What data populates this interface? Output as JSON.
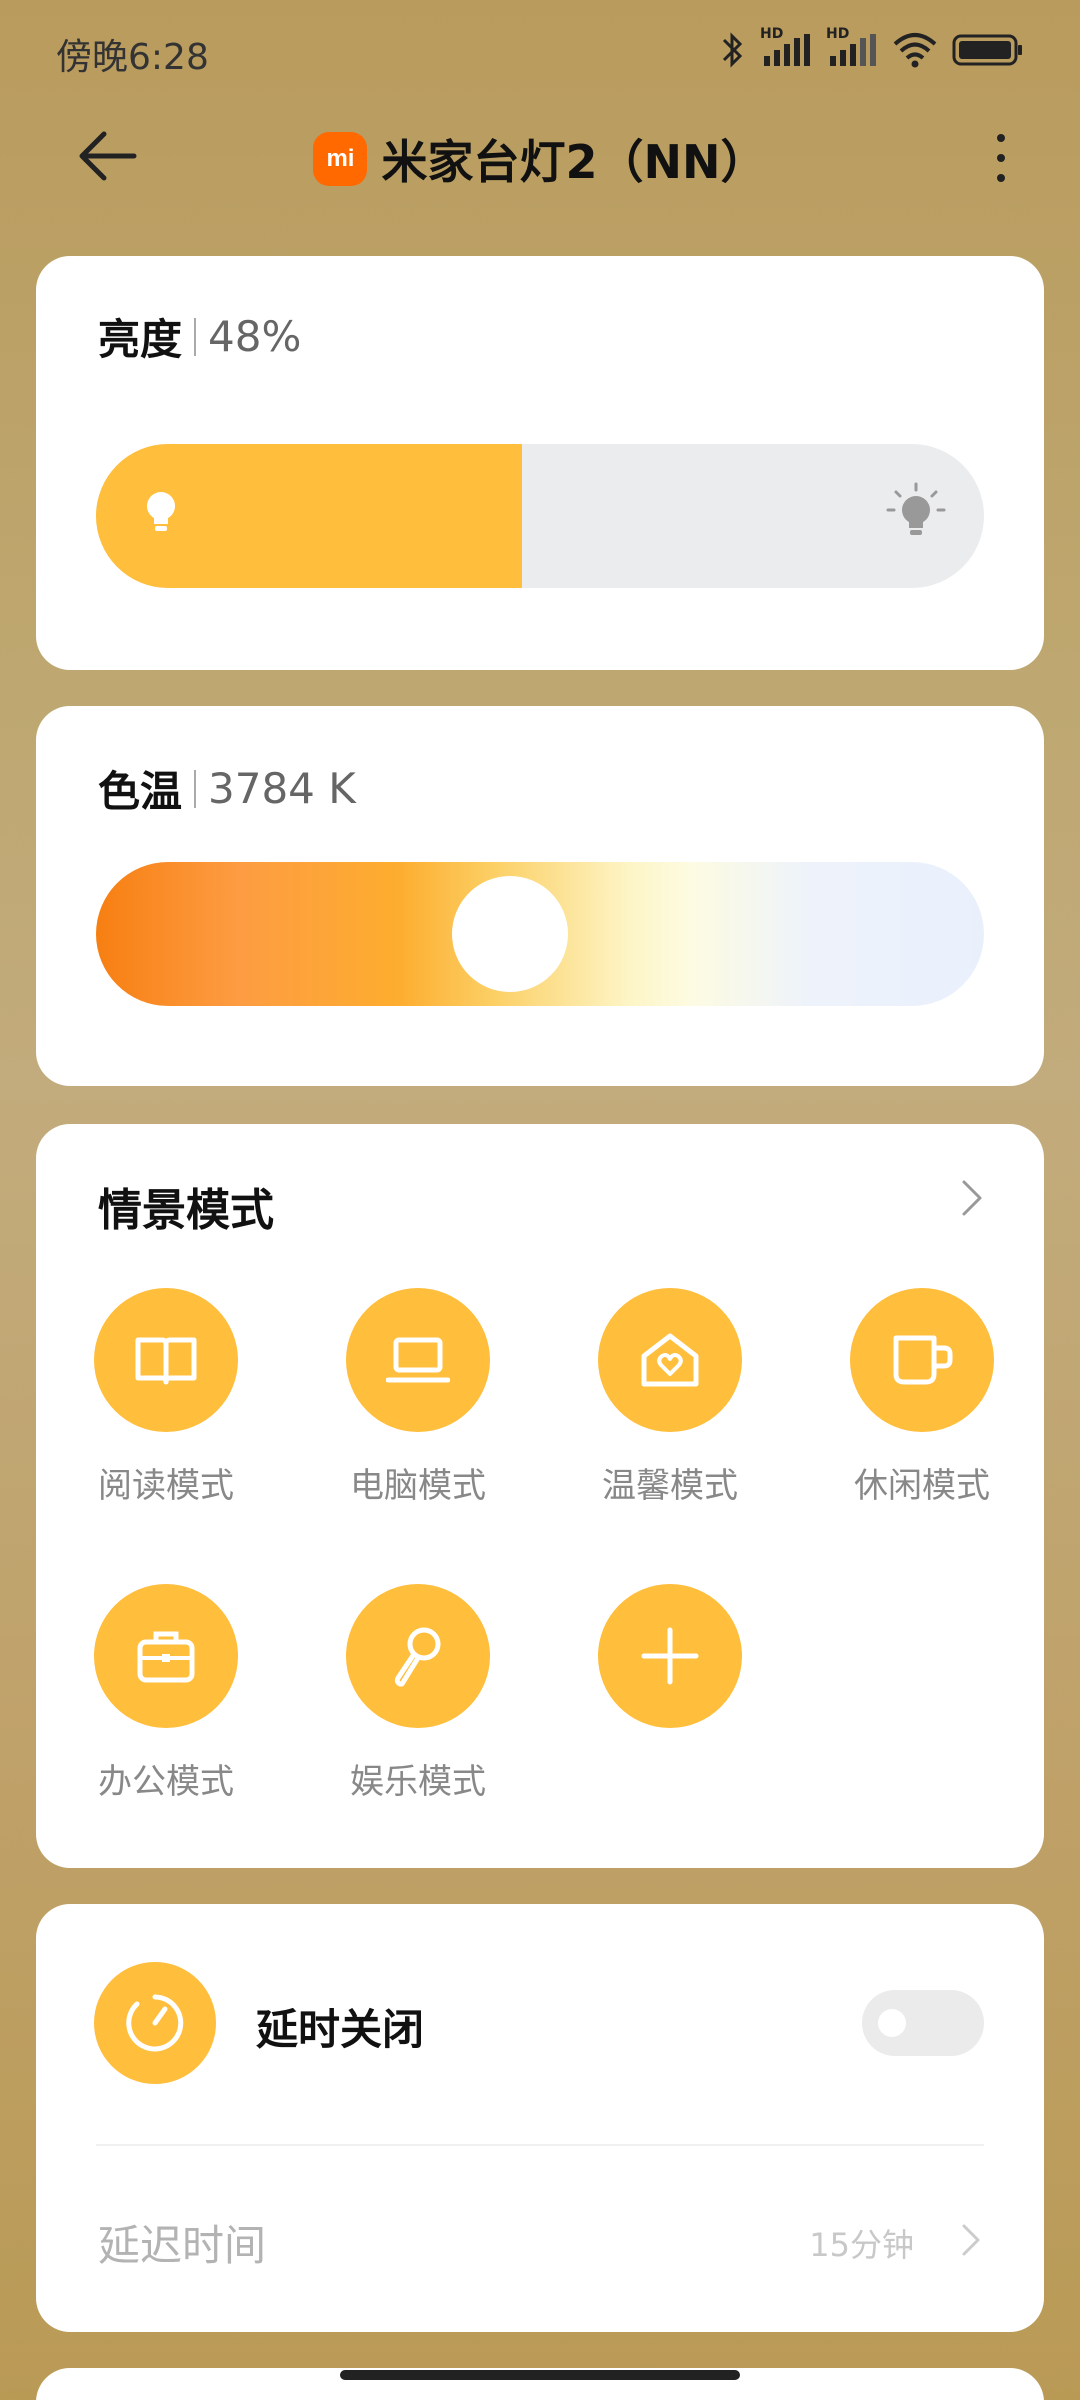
{
  "status_bar": {
    "time": "傍晚6:28",
    "hd1": "HD",
    "hd2": "HD"
  },
  "header": {
    "logo_text": "mi",
    "title": "米家台灯2（NN）"
  },
  "brightness": {
    "label": "亮度",
    "value_text": "48%",
    "level": 0.48
  },
  "color_temp": {
    "label": "色温",
    "value_text": "3784 K",
    "level": 0.46
  },
  "scenes": {
    "title": "情景模式",
    "items": [
      {
        "label": "阅读模式",
        "icon": "book-icon"
      },
      {
        "label": "电脑模式",
        "icon": "laptop-icon"
      },
      {
        "label": "温馨模式",
        "icon": "home-heart-icon"
      },
      {
        "label": "休闲模式",
        "icon": "cup-icon"
      },
      {
        "label": "办公模式",
        "icon": "briefcase-icon"
      },
      {
        "label": "娱乐模式",
        "icon": "microphone-icon"
      },
      {
        "label": "",
        "icon": "plus-icon"
      }
    ]
  },
  "timer": {
    "label": "延时关闭",
    "enabled": false,
    "delay_label": "延迟时间",
    "delay_value": "15分钟"
  },
  "colors": {
    "accent": "#ffbe3c",
    "brand": "#ff6900"
  }
}
